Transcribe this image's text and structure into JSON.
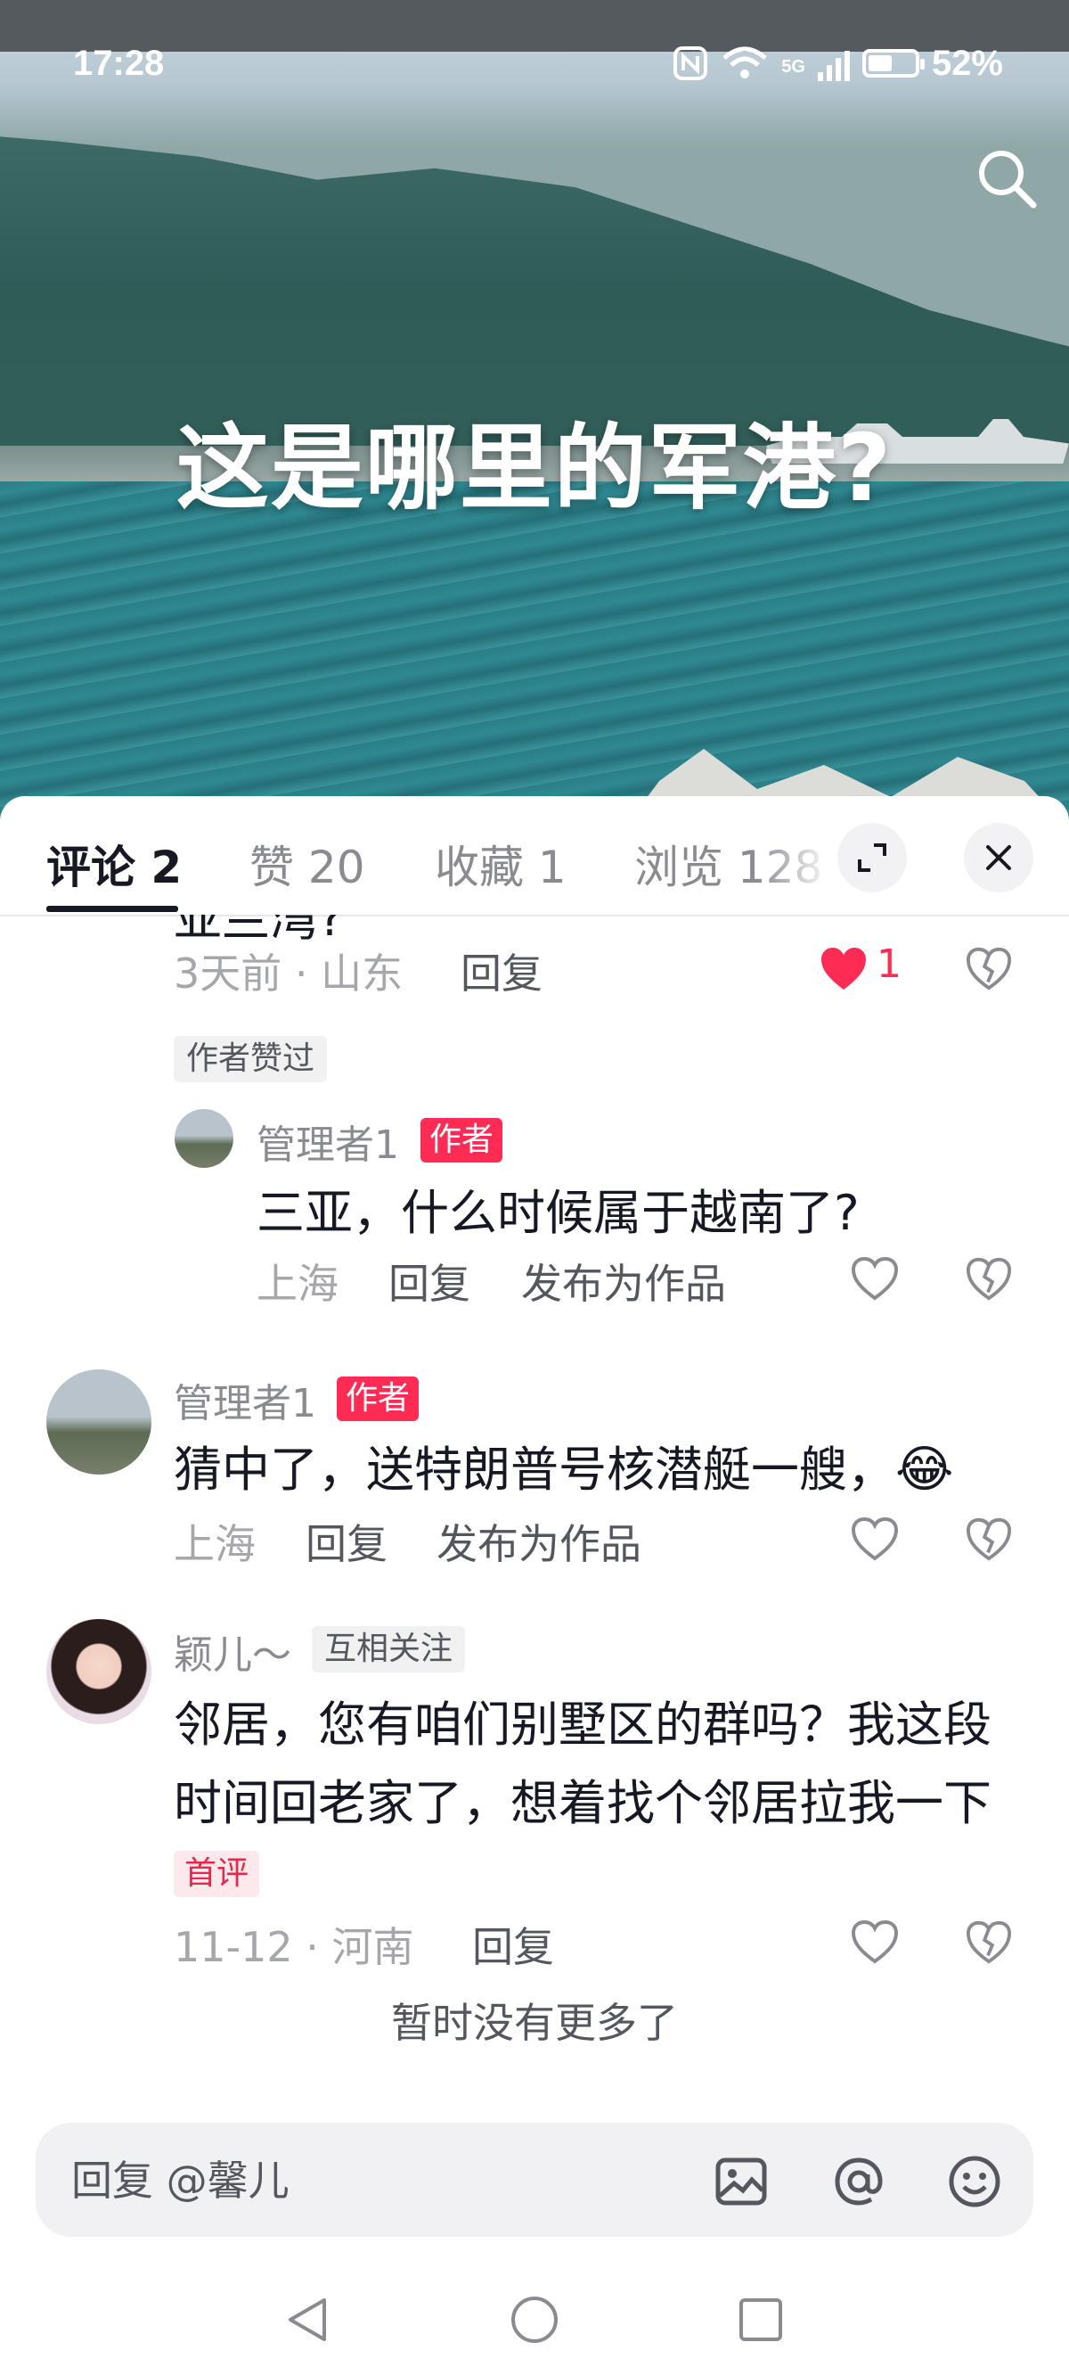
{
  "status_bar": {
    "time": "17:28",
    "battery": "52%",
    "network": "5G"
  },
  "video": {
    "title": "这是哪里的军港?"
  },
  "tabs": [
    {
      "label": "评论 2",
      "active": true
    },
    {
      "label": "赞 20",
      "active": false
    },
    {
      "label": "收藏 1",
      "active": false
    },
    {
      "label": "浏览 128",
      "active": false
    }
  ],
  "comments": [
    {
      "partial_text": "亚兰湾?",
      "meta": "3天前 · 山东",
      "reply_label": "回复",
      "like_count": "1",
      "liked": true,
      "tag": "作者赞过",
      "sub_reply": {
        "name": "管理者1",
        "badge": "作者",
        "text": "三亚，什么时候属于越南了?",
        "location": "上海",
        "reply_label": "回复",
        "publish_label": "发布为作品"
      }
    },
    {
      "name": "管理者1",
      "badge": "作者",
      "text": "猜中了，送特朗普号核潜艇一艘，",
      "emoji": "😂",
      "location": "上海",
      "reply_label": "回复",
      "publish_label": "发布为作品"
    },
    {
      "name": "颖儿～",
      "relation_tag": "互相关注",
      "text_line1": "邻居，您有咱们别墅区的群吗？我这段",
      "text_line2": "时间回老家了，想着找个邻居拉我一下",
      "first_tag": "首评",
      "meta": "11-12 · 河南",
      "reply_label": "回复"
    }
  ],
  "end_text": "暂时没有更多了",
  "input": {
    "placeholder": "回复 @馨儿"
  },
  "colors": {
    "accent": "#fe2c55",
    "text": "#161823",
    "muted": "#a6a7ab"
  }
}
